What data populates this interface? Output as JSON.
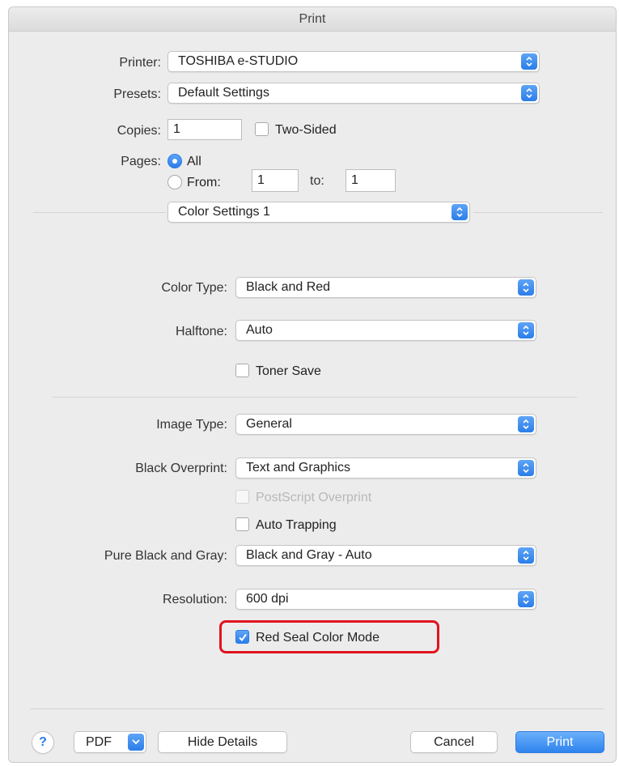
{
  "window": {
    "title": "Print"
  },
  "printer": {
    "label": "Printer:",
    "value": "TOSHIBA e-STUDIO"
  },
  "presets": {
    "label": "Presets:",
    "value": "Default Settings"
  },
  "copies": {
    "label": "Copies:",
    "value": "1",
    "two_sided_label": "Two-Sided",
    "two_sided_checked": false
  },
  "pages": {
    "label": "Pages:",
    "all_label": "All",
    "from_label": "From:",
    "from_value": "1",
    "to_label": "to:",
    "to_value": "1",
    "selected": "All"
  },
  "panel": {
    "value": "Color Settings 1"
  },
  "color_type": {
    "label": "Color Type:",
    "value": "Black and Red"
  },
  "halftone": {
    "label": "Halftone:",
    "value": "Auto"
  },
  "toner_save": {
    "label": "Toner Save",
    "checked": false
  },
  "image_type": {
    "label": "Image Type:",
    "value": "General"
  },
  "black_overprint": {
    "label": "Black Overprint:",
    "value": "Text and Graphics"
  },
  "postscript_overprint": {
    "label": "PostScript Overprint",
    "checked": false,
    "enabled": false
  },
  "auto_trapping": {
    "label": "Auto Trapping",
    "checked": false
  },
  "pure_black_gray": {
    "label": "Pure Black and Gray:",
    "value": "Black and Gray - Auto"
  },
  "resolution": {
    "label": "Resolution:",
    "value": "600 dpi"
  },
  "red_seal": {
    "label": "Red Seal Color Mode",
    "checked": true
  },
  "footer": {
    "help_glyph": "?",
    "pdf_label": "PDF",
    "hide_details_label": "Hide Details",
    "cancel_label": "Cancel",
    "print_label": "Print"
  },
  "colors": {
    "accent": "#2b7de9",
    "highlight": "#e0141e"
  }
}
